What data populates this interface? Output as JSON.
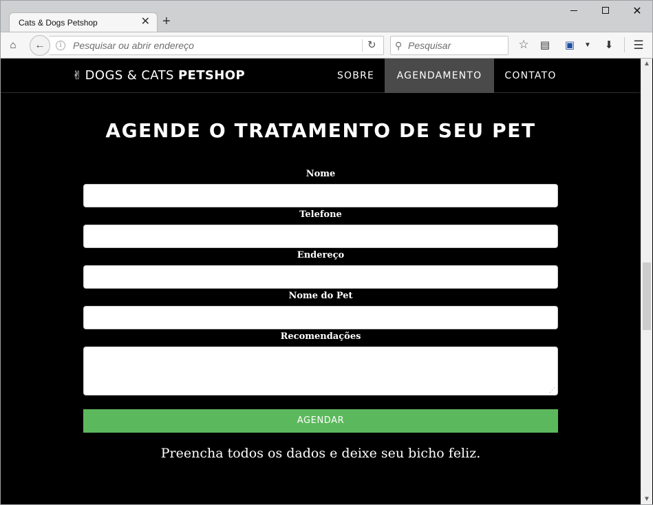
{
  "browser": {
    "tab_title": "Cats & Dogs Petshop",
    "tab_close_glyph": "✕",
    "new_tab_glyph": "+",
    "url_placeholder": "Pesquisar ou abrir endereço",
    "search_placeholder": "Pesquisar"
  },
  "site": {
    "brand_light": "DOGS & CATS ",
    "brand_bold": "PETSHOP",
    "nav": [
      "SOBRE",
      "AGENDAMENTO",
      "CONTATO"
    ],
    "active_nav": "AGENDAMENTO"
  },
  "form": {
    "heading": "AGENDE O TRATAMENTO DE SEU PET",
    "fields": [
      {
        "label": "Nome",
        "value": ""
      },
      {
        "label": "Telefone",
        "value": ""
      },
      {
        "label": "Endereço",
        "value": ""
      },
      {
        "label": "Nome do Pet",
        "value": ""
      },
      {
        "label": "Recomendações",
        "value": ""
      }
    ],
    "submit_label": "AGENDAR",
    "tagline": "Preencha todos os dados e deixe seu bicho feliz."
  },
  "colors": {
    "page_background": "#000000",
    "active_nav_background": "#4a4a4a",
    "submit_background": "#5cb85c"
  },
  "icons": [
    "home-icon",
    "back-icon",
    "info-icon",
    "reload-icon",
    "search-icon",
    "bookmark-star-icon",
    "reading-list-icon",
    "save-icon",
    "dropdown-arrow-icon",
    "download-icon",
    "hamburger-menu-icon",
    "peace-hand-icon"
  ]
}
